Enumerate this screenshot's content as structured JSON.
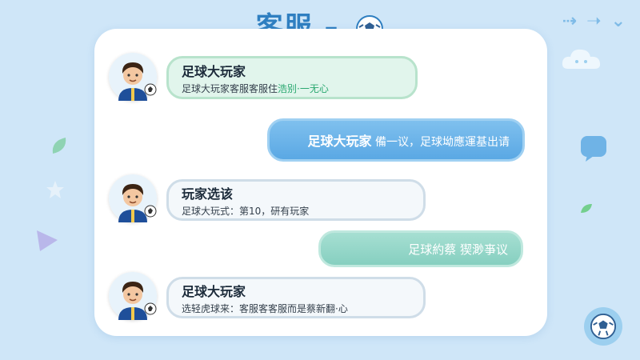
{
  "header": {
    "title": "客服 –",
    "nav_icons": [
      "arrow-right",
      "arrow-right",
      "chevron-down"
    ]
  },
  "messages": [
    {
      "side": "in",
      "name": "足球大玩家",
      "text": "足球大玩家客服客服住",
      "text_tail": "浩别·一无心"
    },
    {
      "side": "out",
      "name": "足球大玩家",
      "text": "備一议，足球坳應運基出请"
    },
    {
      "side": "in",
      "name": "玩家选该",
      "text": "足球大玩式：第10，研有玩家"
    },
    {
      "side": "out",
      "text": "足球約蔡 猰渺亊议"
    },
    {
      "side": "in",
      "name": "足球大玩家",
      "text": "选轻虎球来：客服客客服而是蔡新翻·心"
    }
  ],
  "colors": {
    "background": "#cfe6f8",
    "title": "#2f7fc1",
    "bubble_blue": "#5aa8e4",
    "bubble_green": "#86cfc0",
    "accent_green": "#2aa870"
  }
}
